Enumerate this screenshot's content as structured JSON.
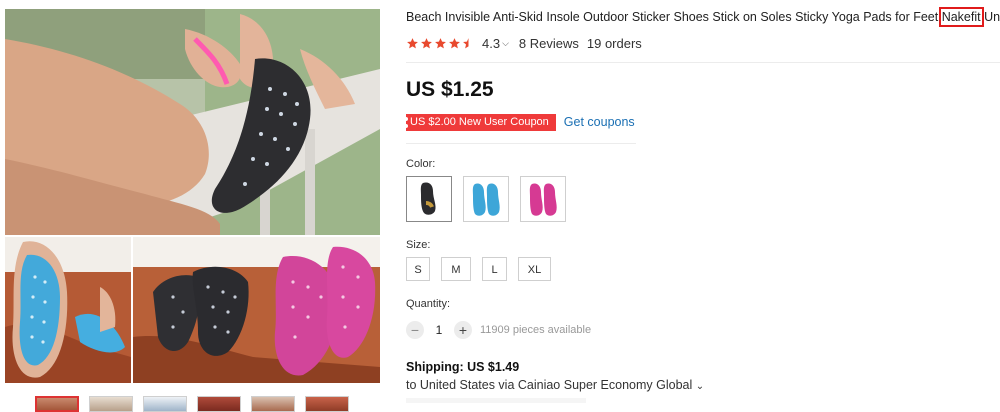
{
  "product": {
    "title_before": "Beach Invisible Anti-Skid Insole Outdoor Sticker Shoes Stick on Soles Sticky Yoga Pads for Feet ",
    "title_highlight": "Nakefit",
    "title_after": " Unisex",
    "rating": "4.3",
    "rating_value": 4.3,
    "reviews": "8 Reviews",
    "orders": "19 orders",
    "price": "US $1.25",
    "coupon": "US $2.00 New User Coupon",
    "get_coupons": "Get coupons"
  },
  "options": {
    "color_label": "Color:",
    "colors": [
      "black",
      "blue",
      "pink"
    ],
    "size_label": "Size:",
    "sizes": [
      "S",
      "M",
      "L",
      "XL"
    ],
    "quantity_label": "Quantity:",
    "quantity": "1",
    "minus": "−",
    "plus": "+",
    "available": "11909 pieces available"
  },
  "shipping": {
    "label": "Shipping: US $1.49",
    "detail": "to United States via Cainiao Super Economy Global",
    "chevron": "⌄"
  },
  "icons": {
    "star": "star-icon",
    "half_star": "half-star-icon",
    "chevron": "chevron-down-icon"
  },
  "colors": {
    "star": "#e8492e",
    "coupon_bg": "#ef3a3a",
    "link": "#1a6fb3",
    "highlight_box": "#e01b1b",
    "pad_black": "#2b2b2e",
    "pad_blue": "#3da6d8",
    "pad_pink": "#d63a93"
  }
}
